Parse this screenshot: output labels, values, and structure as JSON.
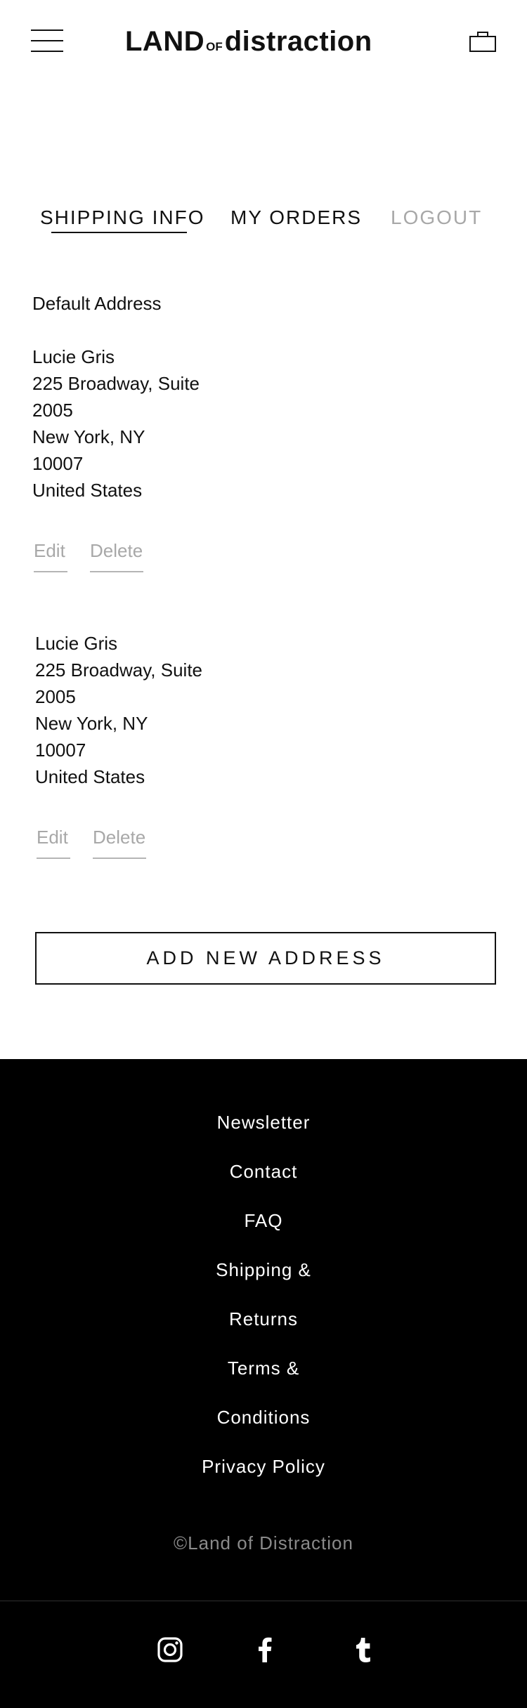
{
  "header": {
    "logo": {
      "part1": "LAND",
      "part2": "OF",
      "part3": "distraction"
    },
    "menu_icon": "hamburger-menu-icon",
    "bag_icon": "shopping-bag-icon"
  },
  "tabs": [
    {
      "label": "SHIPPING INFO",
      "active": true
    },
    {
      "label": "MY ORDERS",
      "active": false
    },
    {
      "label": "LOGOUT",
      "active": false
    }
  ],
  "default_label": "Default Address",
  "addresses": [
    {
      "lines": [
        "Lucie Gris",
        "225 Broadway, Suite",
        "2005",
        "New York, NY",
        "10007",
        "United States"
      ],
      "edit": "Edit",
      "delete": "Delete"
    },
    {
      "lines": [
        "Lucie Gris",
        "225 Broadway, Suite",
        "2005",
        "New York, NY",
        "10007",
        "United States"
      ],
      "edit": "Edit",
      "delete": "Delete"
    }
  ],
  "add_button": "ADD NEW ADDRESS",
  "footer": {
    "links": [
      "Newsletter",
      "Contact",
      "FAQ",
      "Shipping &",
      "Returns",
      "Terms &",
      "Conditions",
      "Privacy Policy"
    ],
    "copyright": "©Land of Distraction",
    "social": [
      "instagram-icon",
      "facebook-icon",
      "tumblr-icon"
    ]
  },
  "colors": {
    "text": "#111111",
    "muted": "#a8a8a8",
    "footer_bg": "#000000",
    "footer_text": "#ffffff",
    "copyright": "#8a8a8a"
  }
}
